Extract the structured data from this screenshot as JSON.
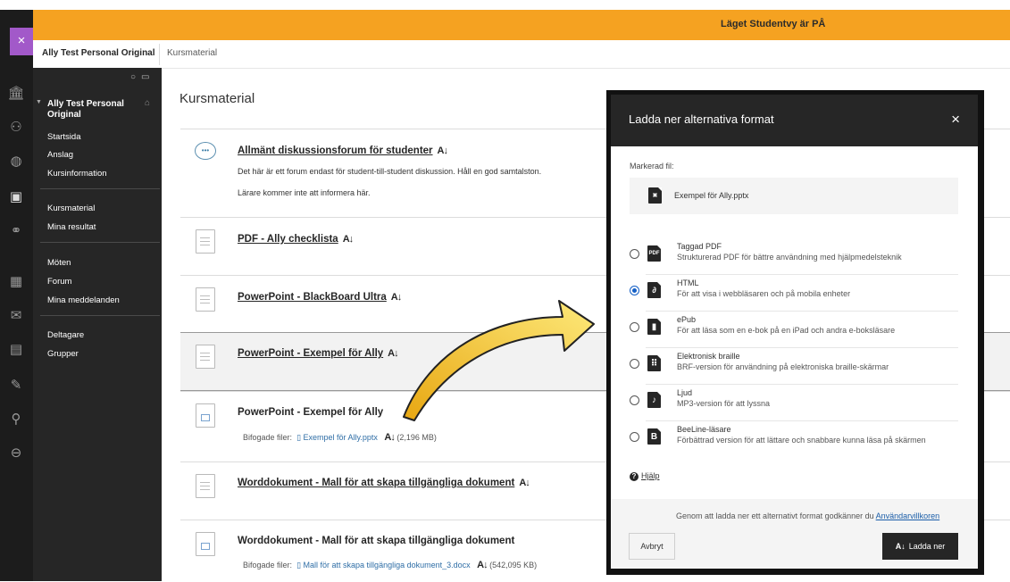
{
  "banner": {
    "text": "Läget Studentvy är PÅ"
  },
  "breadcrumb": {
    "course": "Ally Test Personal Original",
    "page": "Kursmaterial"
  },
  "rail": {
    "close_symbol": "×"
  },
  "course_menu": {
    "title": "Ally Test Personal Original",
    "groups": [
      [
        "Startsida",
        "Anslag",
        "Kursinformation"
      ],
      [
        "Kursmaterial",
        "Mina resultat"
      ],
      [
        "Möten",
        "Forum",
        "Mina meddelanden"
      ],
      [
        "Deltagare",
        "Grupper"
      ]
    ]
  },
  "content": {
    "page_title": "Kursmaterial",
    "ally_symbol": "A↓",
    "items": [
      {
        "title": "Allmänt diskussionsforum för studenter",
        "lines": [
          "Det här är ett forum endast för student-till-student diskussion. Håll en god samtalston.",
          "Lärare kommer inte att informera här."
        ]
      },
      {
        "title": "PDF - Ally checklista"
      },
      {
        "title": "PowerPoint - BlackBoard Ultra"
      },
      {
        "title": "PowerPoint - Exempel för Ally"
      },
      {
        "title": "PowerPoint - Exempel för Ally",
        "attach_label": "Bifogade filer:",
        "attach_file": "Exempel för Ally.pptx",
        "attach_size": "(2,196 MB)"
      },
      {
        "title": "Worddokument - Mall för att skapa tillgängliga dokument"
      },
      {
        "title": "Worddokument - Mall för att skapa tillgängliga dokument",
        "attach_label": "Bifogade filer:",
        "attach_file": "Mall för att skapa tillgängliga dokument_3.docx",
        "attach_size": "(542,095 KB)"
      }
    ]
  },
  "modal": {
    "title": "Ladda ner alternativa format",
    "close_symbol": "×",
    "selected_label": "Markerad fil:",
    "selected_file": "Exempel för Ally.pptx",
    "options": [
      {
        "name": "Taggad PDF",
        "desc": "Strukturerad PDF för bättre användning med hjälpmedelsteknik",
        "icon": "PDF"
      },
      {
        "name": "HTML",
        "desc": "För att visa i webbläsaren och på mobila enheter",
        "icon": "∂"
      },
      {
        "name": "ePub",
        "desc": "För att läsa som en e-bok på en iPad och andra e-boksläsare",
        "icon": "▮"
      },
      {
        "name": "Elektronisk braille",
        "desc": "BRF-version för användning på elektroniska braille-skärmar",
        "icon": "⠿"
      },
      {
        "name": "Ljud",
        "desc": "MP3-version för att lyssna",
        "icon": "♪"
      },
      {
        "name": "BeeLine-läsare",
        "desc": "Förbättrad version för att lättare och snabbare kunna läsa på skärmen",
        "icon": "B"
      }
    ],
    "selected_option": "HTML",
    "help": "Hjälp",
    "terms_text": "Genom att ladda ner ett alternativt format godkänner du ",
    "terms_link": "Användarvillkoren",
    "cancel": "Avbryt",
    "download": "Ladda ner"
  },
  "colors": {
    "banner": "#f5a221",
    "rail": "#1c1c1c",
    "menu": "#262626",
    "accent": "#a259c9",
    "radio": "#1560c6",
    "link": "#2f6ea6"
  }
}
